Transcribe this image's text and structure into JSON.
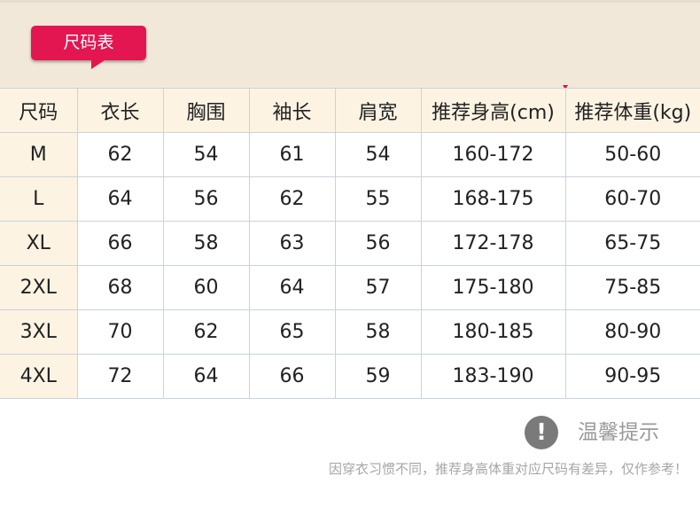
{
  "header": {
    "title": "尺码表"
  },
  "table": {
    "headers": [
      "尺码",
      "衣长",
      "胸围",
      "袖长",
      "肩宽",
      "推荐身高(cm)",
      "推荐体重(kg)"
    ],
    "rows": [
      [
        "M",
        "62",
        "54",
        "61",
        "54",
        "160-172",
        "50-60"
      ],
      [
        "L",
        "64",
        "56",
        "62",
        "55",
        "168-175",
        "60-70"
      ],
      [
        "XL",
        "66",
        "58",
        "63",
        "56",
        "172-178",
        "65-75"
      ],
      [
        "2XL",
        "68",
        "60",
        "64",
        "57",
        "175-180",
        "75-85"
      ],
      [
        "3XL",
        "70",
        "62",
        "65",
        "58",
        "180-185",
        "80-90"
      ],
      [
        "4XL",
        "72",
        "64",
        "66",
        "59",
        "183-190",
        "90-95"
      ]
    ]
  },
  "notice": {
    "icon": "exclamation-icon",
    "icon_glyph": "!",
    "title": "温馨提示",
    "text": "因穿衣习惯不同，推荐身高体重对应尺码有差异，仅作参考！"
  },
  "colors": {
    "band": "#f2e8da",
    "tag": "#e31651",
    "header_cell": "#fdf3e3",
    "grid": "#c9d3dd"
  }
}
